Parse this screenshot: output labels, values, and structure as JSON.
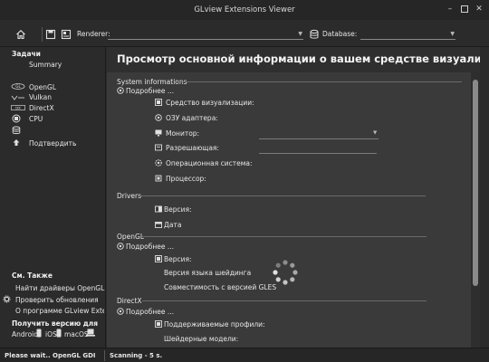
{
  "window": {
    "title": "GLview Extensions Viewer",
    "minimize": "–",
    "close": "✕"
  },
  "toolbar": {
    "renderer_label": "Renderer:",
    "renderer_value": "",
    "database_label": "Database:",
    "database_value": "",
    "icons": [
      "home-icon",
      "save-icon",
      "report-icon",
      "database-icon"
    ]
  },
  "sidebar": {
    "tasks_header": "Задачи",
    "summary": "Summary",
    "nav": [
      {
        "label": "OpenGL",
        "icon": "opengl-logo"
      },
      {
        "label": "Vulkan",
        "icon": "vulkan-logo"
      },
      {
        "label": "DirectX",
        "icon": "directx-logo"
      },
      {
        "label": "CPU",
        "icon": "cpu-icon"
      },
      {
        "label": "",
        "icon": "database-icon"
      },
      {
        "label": "Подтвердить",
        "icon": "upload-icon"
      }
    ],
    "see_also_header": "См. Также",
    "links": [
      "Найти драйверы OpenGL ...",
      "Проверить обновления",
      "О программе GLview Extensions ..."
    ],
    "get_version_header": "Получить версию для",
    "platforms": [
      "Android",
      "iOS",
      "macOS"
    ]
  },
  "content": {
    "title": "Просмотр основной информации о вашем средстве визуализации графики",
    "system": {
      "label": "System informations",
      "more": "Подробнее ...",
      "rows": [
        "Средство визуализации:",
        "ОЗУ адаптера:",
        "Монитор:",
        "Разрешающая:",
        "Операционная система:",
        "Процессор:"
      ]
    },
    "drivers": {
      "label": "Drivers",
      "rows": [
        "Версия:",
        "Дата"
      ]
    },
    "opengl": {
      "label": "OpenGL",
      "more": "Подробнее ...",
      "rows": [
        "Версия:",
        "Версия языка шейдинга",
        "Совместимость с версией GLES"
      ]
    },
    "directx": {
      "label": "DirectX",
      "more": "Подробнее ...",
      "rows": [
        "Поддерживаемые профили:",
        "Шейдерные модели:"
      ]
    }
  },
  "status": {
    "left": "Please wait.. OpenGL GDI",
    "middle": "Scanning - 5 s."
  }
}
